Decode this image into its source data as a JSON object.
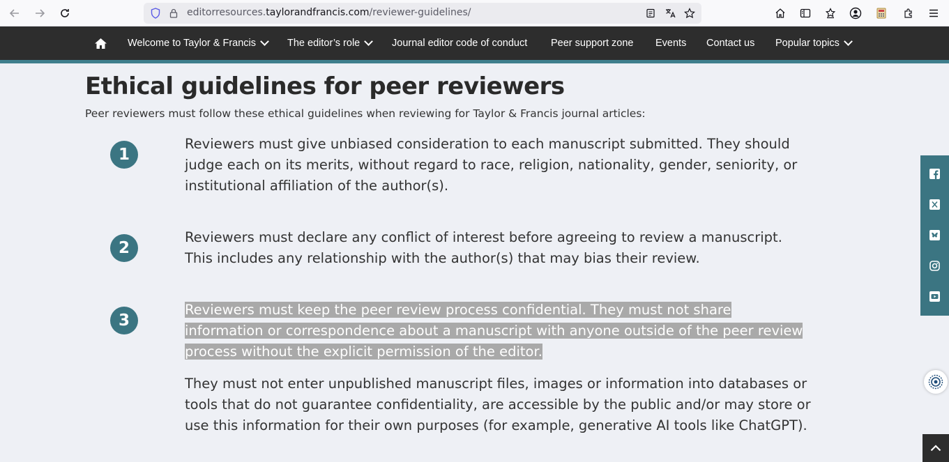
{
  "browser": {
    "url_prefix": "editorresources.",
    "url_domain": "taylorandfrancis.com",
    "url_path": "/reviewer-guidelines/"
  },
  "nav": {
    "items": [
      {
        "label": "Welcome to Taylor & Francis",
        "has_dropdown": true
      },
      {
        "label": "The editor’s role",
        "has_dropdown": true
      },
      {
        "label": "Journal editor code of conduct",
        "has_dropdown": false
      },
      {
        "label": "Peer support zone",
        "has_dropdown": false
      },
      {
        "label": "Events",
        "has_dropdown": false
      },
      {
        "label": "Contact us",
        "has_dropdown": false
      },
      {
        "label": "Popular topics",
        "has_dropdown": true
      }
    ]
  },
  "content": {
    "title": "Ethical guidelines for peer reviewers",
    "intro": "Peer reviewers must follow these ethical guidelines when reviewing for Taylor & Francis journal articles:",
    "guidelines": [
      {
        "number": "1",
        "text": "Reviewers must give unbiased consideration to each manuscript submitted. They should judge each on its merits, without regard to race, religion, nationality, gender, seniority, or institutional affiliation of the author(s)."
      },
      {
        "number": "2",
        "text": "Reviewers must declare any conflict of interest before agreeing to review a manuscript. This includes any relationship with the author(s) that may bias their review."
      },
      {
        "number": "3",
        "text": "Reviewers must keep the peer review process confidential. They must not share information or correspondence about a manuscript with anyone outside of the peer review process without the explicit permission of the editor.",
        "extra": "They must not enter unpublished manuscript files, images or information into databases or tools that do not guarantee confidentiality, are accessible by the public and/or may store or use this information for their own purposes (for example, generative AI tools like ChatGPT)."
      }
    ]
  },
  "social": [
    "facebook-icon",
    "x-icon",
    "bluesky-icon",
    "instagram-icon",
    "youtube-icon"
  ],
  "colors": {
    "nav_bg": "#2d2d2d",
    "accent": "#3b7582",
    "page_bg": "#eef0f5",
    "selection": "#a9a9a9"
  }
}
